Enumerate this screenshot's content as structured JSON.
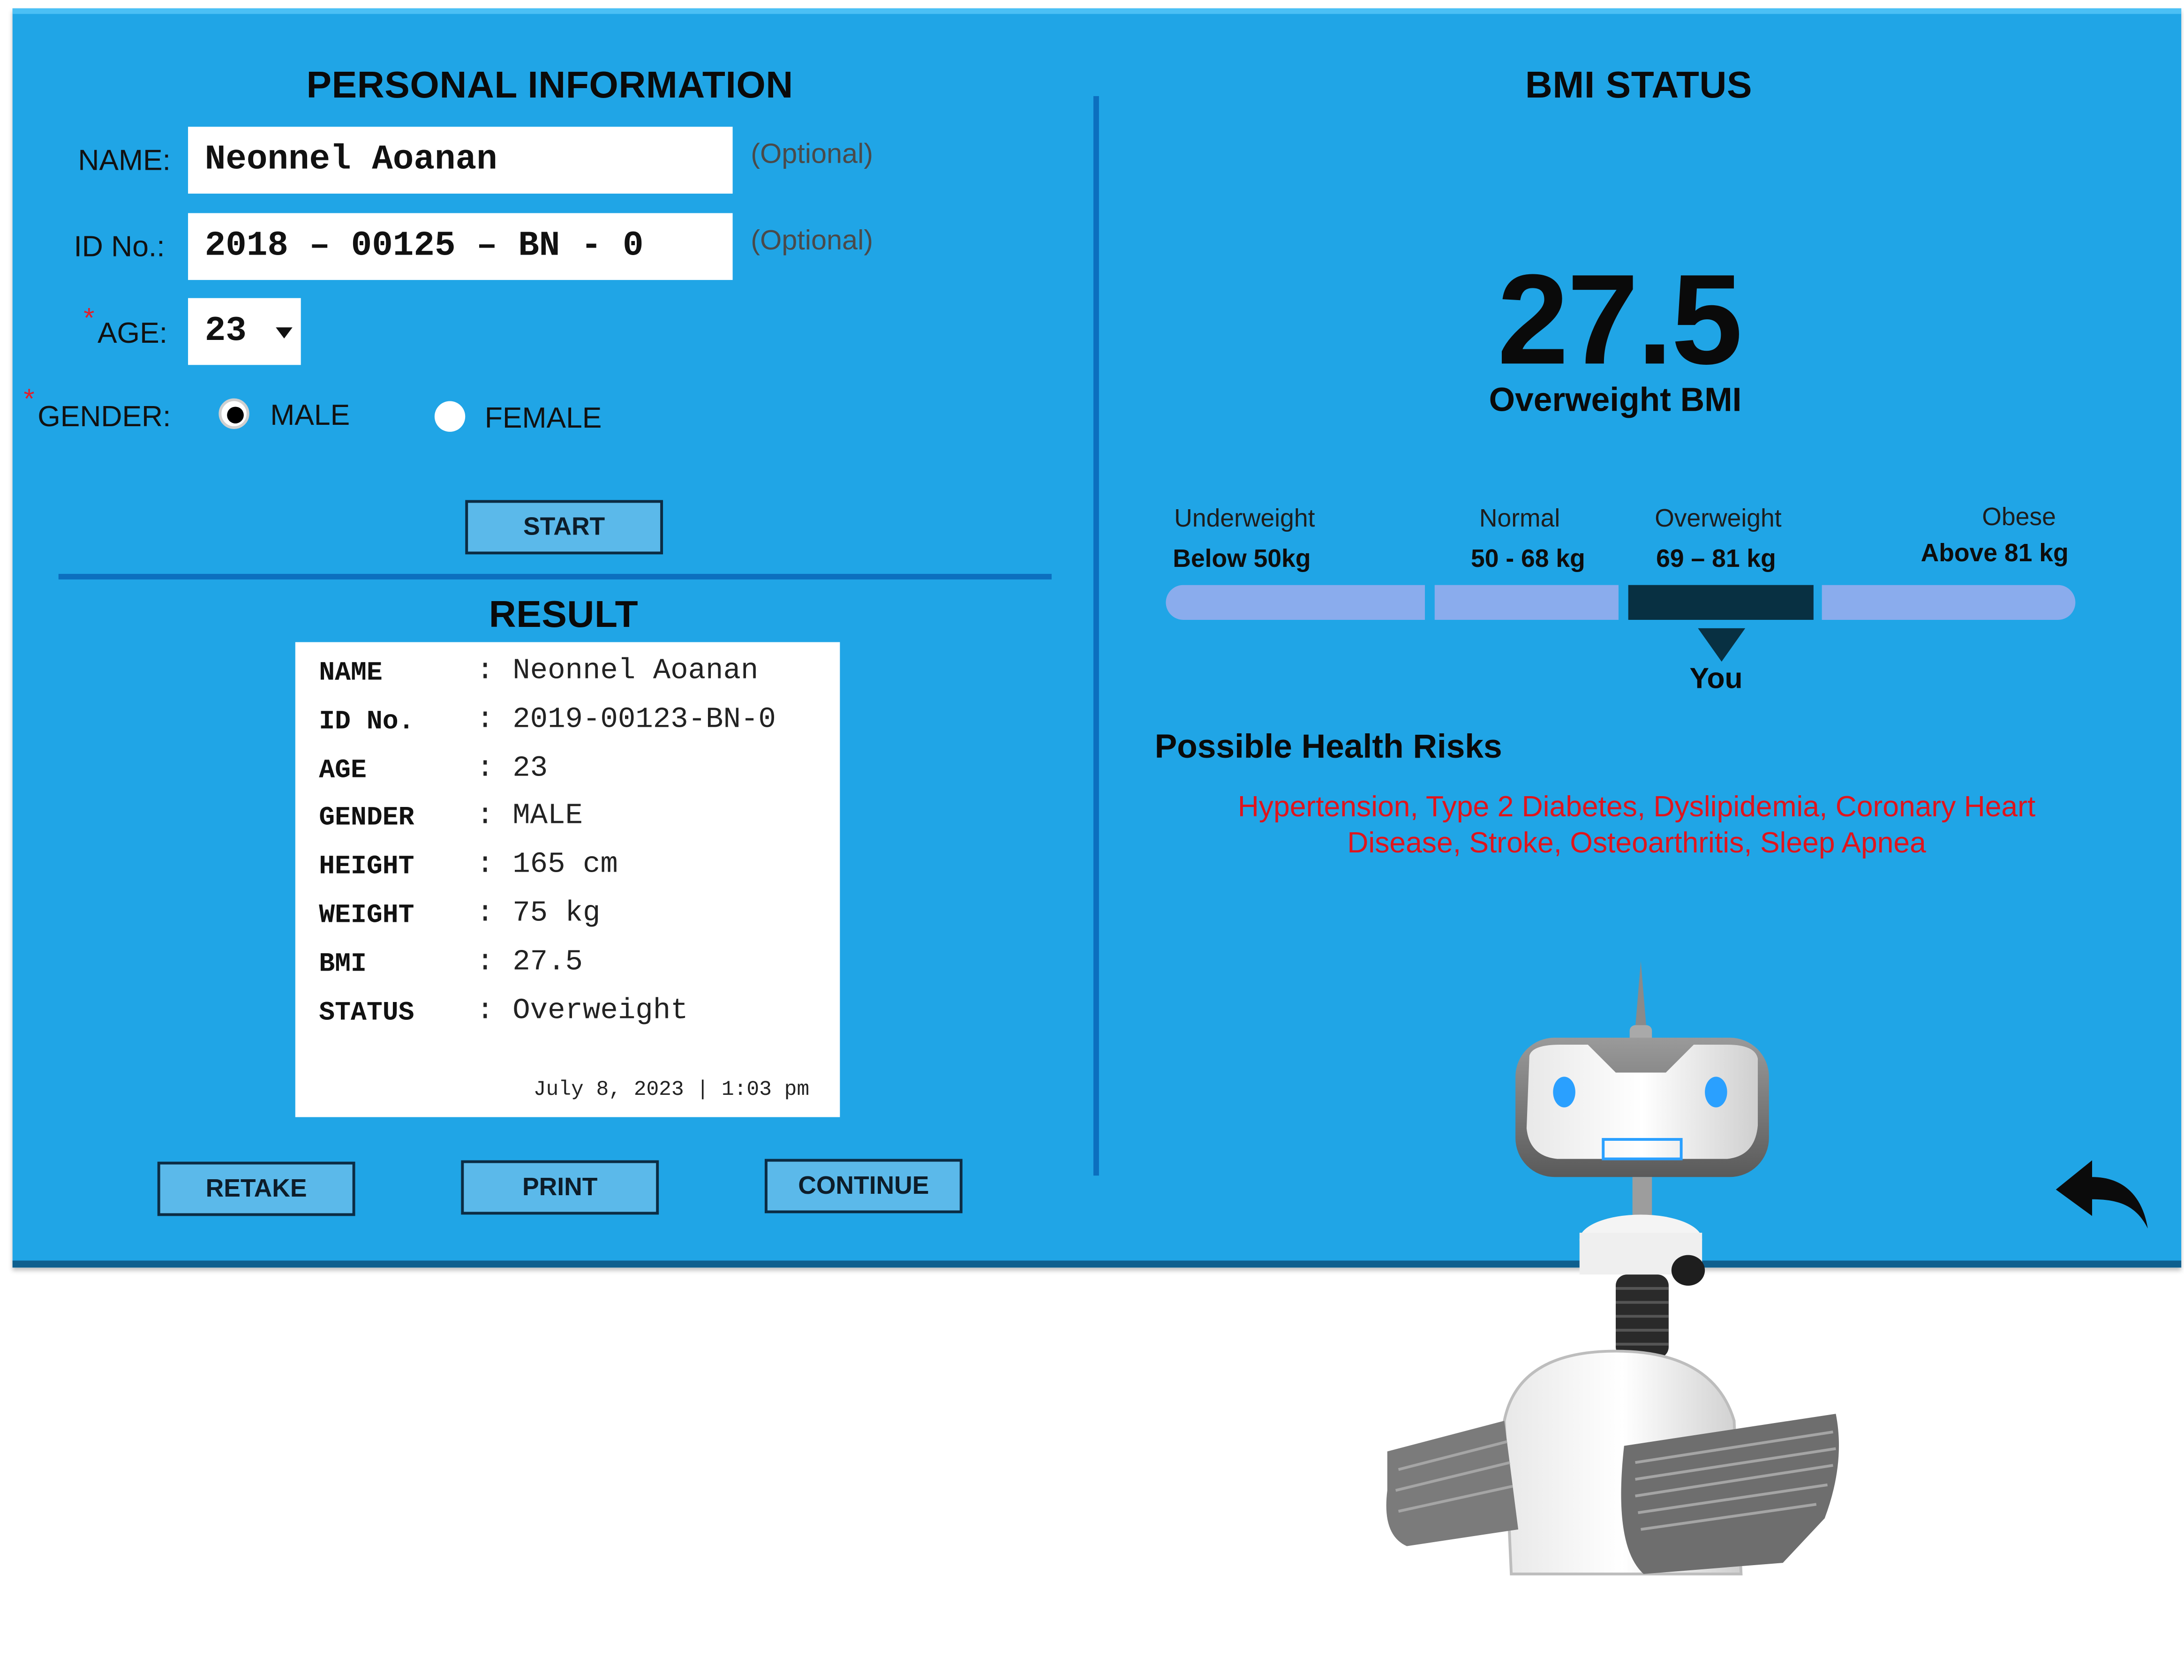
{
  "personal": {
    "title": "PERSONAL INFORMATION",
    "name_label": "NAME:",
    "name_value": "Neonnel Aoanan",
    "name_hint": "(Optional)",
    "id_label": "ID No.:",
    "id_value": "2018 – 00125 – BN - 0",
    "id_hint": "(Optional)",
    "age_label": "AGE:",
    "age_value": "23",
    "required_mark": "*",
    "gender_label": "GENDER:",
    "gender_options": [
      "MALE",
      "FEMALE"
    ],
    "gender_selected": "MALE",
    "start_label": "START"
  },
  "result": {
    "title": "RESULT",
    "rows": [
      {
        "key": "NAME",
        "value": "Neonnel Aoanan"
      },
      {
        "key": "ID No.",
        "value": "2019-00123-BN-0"
      },
      {
        "key": "AGE",
        "value": "23"
      },
      {
        "key": "GENDER",
        "value": "MALE"
      },
      {
        "key": "HEIGHT",
        "value": "165 cm"
      },
      {
        "key": "WEIGHT",
        "value": "75 kg"
      },
      {
        "key": "BMI",
        "value": "27.5"
      },
      {
        "key": "STATUS",
        "value": "Overweight"
      }
    ],
    "separator": ":",
    "timestamp": "July 8, 2023 | 1:03 pm",
    "buttons": {
      "retake": "RETAKE",
      "print": "PRINT",
      "continue": "CONTINUE"
    }
  },
  "bmi": {
    "title": "BMI STATUS",
    "value": "27.5",
    "status": "Overweight BMI",
    "categories": [
      {
        "name": "Underweight",
        "range": "Below 50kg"
      },
      {
        "name": "Normal",
        "range": "50 - 68 kg"
      },
      {
        "name": "Overweight",
        "range": "69 – 81 kg"
      },
      {
        "name": "Obese",
        "range": "Above 81 kg"
      }
    ],
    "active_category": "Overweight",
    "marker_label": "You",
    "risks_title": "Possible Health Risks",
    "risks_line1": "Hypertension, Type 2 Diabetes, Dyslipidemia, Coronary Heart",
    "risks_line2": "Disease, Stroke, Osteoarthritis, Sleep Apnea"
  },
  "colors": {
    "panel": "#20a5e6",
    "bar_segment": "#8aaced",
    "bar_active": "#083042",
    "button": "#5bb9ea",
    "risk_text": "#e0141c"
  },
  "icons": {
    "back": "back-arrow-icon",
    "dropdown": "caret-down-icon",
    "mascot": "robot-mascot"
  }
}
